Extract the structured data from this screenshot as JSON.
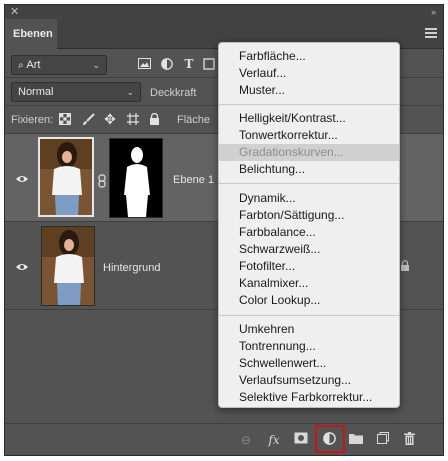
{
  "panel": {
    "tab_label": "Ebenen",
    "filter_kind": "Art",
    "blend_mode": "Normal",
    "opacity_label": "Deckkraft",
    "lock_label": "Fixieren:",
    "fill_label": "Fläche",
    "filter_icons": [
      "image-filter-icon",
      "adjustment-filter-icon",
      "type-filter-icon",
      "shape-filter-icon",
      "smart-object-filter-icon"
    ],
    "lock_icons": [
      "lock-transparent-pixels-icon",
      "lock-image-pixels-icon",
      "lock-position-icon",
      "lock-artboard-icon",
      "lock-all-icon"
    ]
  },
  "layers": [
    {
      "name": "Ebene 1",
      "selected": true,
      "visible": true,
      "has_mask": true
    },
    {
      "name": "Hintergrund",
      "selected": false,
      "visible": true,
      "locked": true
    }
  ],
  "bottom_icons": [
    "link-layers-icon",
    "layer-style-icon",
    "add-mask-icon",
    "new-adjustment-layer-icon",
    "new-group-icon",
    "new-layer-icon",
    "delete-layer-icon"
  ],
  "menu": {
    "group1": [
      "Farbfläche...",
      "Verlauf...",
      "Muster..."
    ],
    "group2": [
      "Helligkeit/Kontrast...",
      "Tonwertkorrektur...",
      "Gradationskurven...",
      "Belichtung..."
    ],
    "group3": [
      "Dynamik...",
      "Farbton/Sättigung...",
      "Farbbalance...",
      "Schwarzweiß...",
      "Fotofilter...",
      "Kanalmixer...",
      "Color Lookup..."
    ],
    "group4": [
      "Umkehren",
      "Tontrennung...",
      "Schwellenwert...",
      "Verlaufsumsetzung...",
      "Selektive Farbkorrektur..."
    ],
    "hovered_item": "Gradationskurven..."
  },
  "colors": {
    "panel_bg": "#535353",
    "menu_bg": "#efefef",
    "highlight": "#c4161c"
  }
}
